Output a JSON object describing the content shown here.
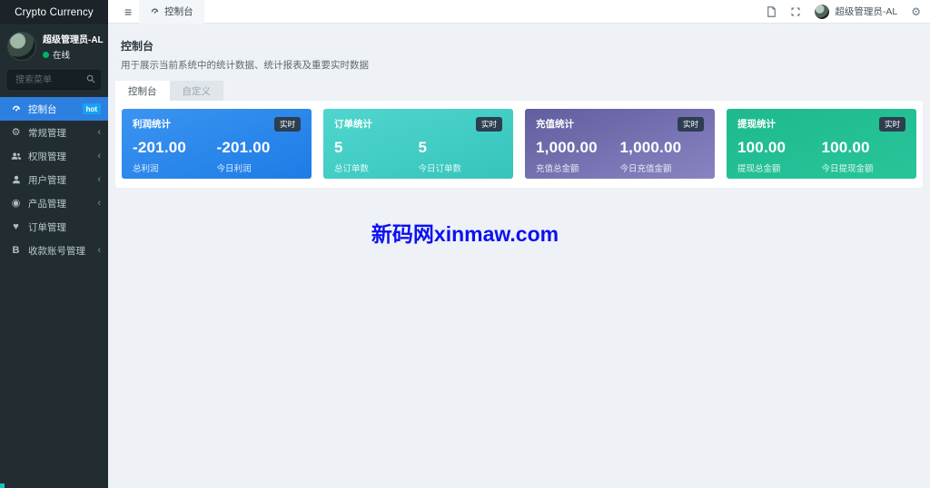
{
  "app": {
    "title": "Crypto Currency"
  },
  "sidebar": {
    "user": {
      "name": "超级管理员-AL",
      "status": "在线"
    },
    "search": {
      "placeholder": "搜索菜单"
    },
    "menu": [
      {
        "label": "控制台",
        "icon": "gauge-icon",
        "badge": "hot",
        "active": true
      },
      {
        "label": "常规管理",
        "icon": "gears-icon",
        "has_children": true
      },
      {
        "label": "权限管理",
        "icon": "user-group-icon",
        "has_children": true
      },
      {
        "label": "用户管理",
        "icon": "user-icon",
        "has_children": true
      },
      {
        "label": "产品管理",
        "icon": "product-icon",
        "has_children": true
      },
      {
        "label": "订单管理",
        "icon": "heart-icon",
        "has_children": false
      },
      {
        "label": "收款账号管理",
        "icon": "bank-icon",
        "has_children": true
      }
    ]
  },
  "navbar": {
    "breadcrumb": "控制台",
    "username": "超级管理员-AL"
  },
  "content": {
    "title": "控制台",
    "description": "用于展示当前系统中的统计数据、统计报表及重要实时数据",
    "tabs": [
      {
        "label": "控制台",
        "active": true
      },
      {
        "label": "自定义",
        "active": false
      }
    ]
  },
  "cards": [
    {
      "title": "利润统计",
      "badge": "实时",
      "left_value": "-201.00",
      "left_label": "总利润",
      "right_value": "-201.00",
      "right_label": "今日利润",
      "gradient_from": "#3b94f0",
      "gradient_to": "#1d7ce6"
    },
    {
      "title": "订单统计",
      "badge": "实时",
      "left_value": "5",
      "left_label": "总订单数",
      "right_value": "5",
      "right_label": "今日订单数",
      "gradient_from": "#4fd6cf",
      "gradient_to": "#36c4bb"
    },
    {
      "title": "充值统计",
      "badge": "实时",
      "left_value": "1,000.00",
      "left_label": "充值总金额",
      "right_value": "1,000.00",
      "right_label": "今日充值金额",
      "gradient_from": "#615e9f",
      "gradient_to": "#8983c1"
    },
    {
      "title": "提现统计",
      "badge": "实时",
      "left_value": "100.00",
      "left_label": "提现总金额",
      "right_value": "100.00",
      "right_label": "今日提现金额",
      "gradient_from": "#1eba8e",
      "gradient_to": "#29c59a"
    }
  ],
  "watermark": {
    "text": "新码网xinmaw.com",
    "color": "#0d10f2"
  },
  "colors": {
    "sidebar_bg": "#222d32",
    "sidebar_active": "#2d7fe0",
    "hot_badge": "#17a2f3",
    "realtime_badge": "#2c3e50",
    "status_online": "#00b36b"
  }
}
